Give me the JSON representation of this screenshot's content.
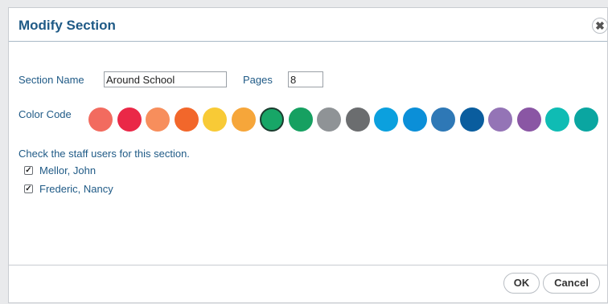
{
  "dialog": {
    "title": "Modify Section",
    "close_glyph": "✖",
    "section_name_label": "Section Name",
    "section_name_value": "Around School",
    "pages_label": "Pages",
    "pages_value": "8",
    "color_code_label": "Color Code",
    "colors": [
      "#f26b5f",
      "#ea2847",
      "#f78e5c",
      "#f2672b",
      "#f8ca36",
      "#f6a63a",
      "#17a667",
      "#16a061",
      "#8f9396",
      "#6b6d6f",
      "#0ba0de",
      "#0b8fd8",
      "#2e78b6",
      "#0a5d9e",
      "#9474b6",
      "#8a56a4",
      "#0fbcb4",
      "#0aa6a1"
    ],
    "selected_color_index": 6,
    "staff_prompt": "Check the staff users for this section.",
    "staff": [
      {
        "name": "Mellor, John",
        "checked": true
      },
      {
        "name": "Frederic, Nancy",
        "checked": true
      }
    ],
    "ok_label": "OK",
    "cancel_label": "Cancel"
  }
}
